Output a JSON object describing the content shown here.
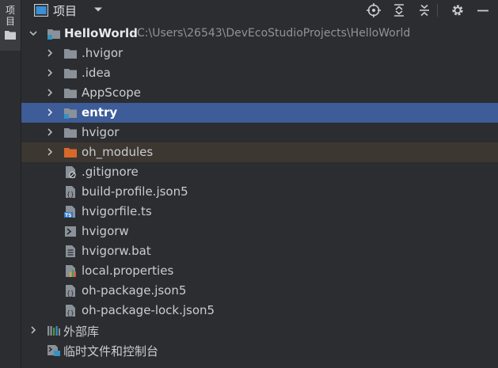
{
  "side_strip": {
    "tab_label": "项目"
  },
  "header": {
    "title": "项目"
  },
  "toolbar": {
    "locate_icon": "crosshair-icon",
    "expand_icon": "expand-all-icon",
    "collapse_icon": "collapse-all-icon",
    "settings_icon": "gear-icon",
    "hide_icon": "minimize-icon"
  },
  "tree": {
    "root": {
      "name": "HelloWorld",
      "path": "C:\\Users\\26543\\DevEcoStudioProjects\\HelloWorld"
    },
    "folders": [
      {
        "name": ".hvigor"
      },
      {
        "name": ".idea"
      },
      {
        "name": "AppScope"
      },
      {
        "name": "entry",
        "state": "selected"
      },
      {
        "name": "hvigor"
      },
      {
        "name": "oh_modules",
        "state": "excluded"
      }
    ],
    "files": [
      {
        "name": ".gitignore",
        "icon": "gitignore-file-icon"
      },
      {
        "name": "build-profile.json5",
        "icon": "json5-file-icon"
      },
      {
        "name": "hvigorfile.ts",
        "icon": "typescript-file-icon"
      },
      {
        "name": "hvigorw",
        "icon": "shell-script-icon"
      },
      {
        "name": "hvigorw.bat",
        "icon": "text-file-icon"
      },
      {
        "name": "local.properties",
        "icon": "properties-file-icon"
      },
      {
        "name": "oh-package.json5",
        "icon": "json5-file-icon"
      },
      {
        "name": "oh-package-lock.json5",
        "icon": "json5-file-icon"
      }
    ],
    "external_libraries": "外部库",
    "scratches": "临时文件和控制台"
  },
  "colors": {
    "background": "#2b2d30",
    "selected_row": "#3d5c98",
    "excluded_row": "#3d3731",
    "folder": "#8b9199",
    "excluded_folder": "#d9682b",
    "module_badge": "#3592c4"
  }
}
